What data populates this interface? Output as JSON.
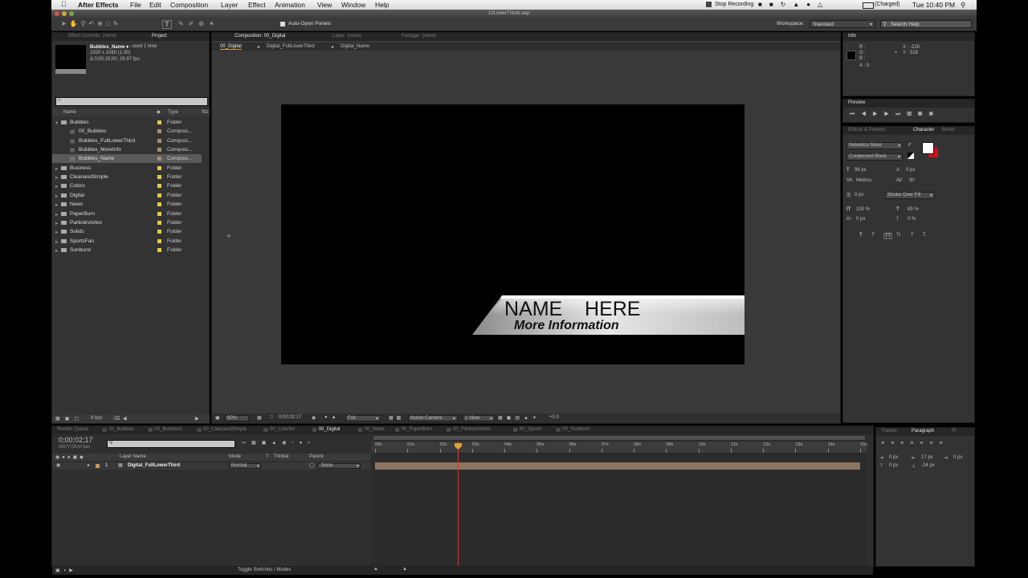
{
  "menubar": {
    "app_name": "After Effects",
    "items": [
      "File",
      "Edit",
      "Composition",
      "Layer",
      "Effect",
      "Animation",
      "View",
      "Window",
      "Help"
    ],
    "stop_recording": "Stop Recording",
    "battery": "(Charged)",
    "clock": "Tue 10:40 PM"
  },
  "window": {
    "title": "10LowerThirds.aep"
  },
  "toolbar": {
    "auto_open": "Auto-Open Panels",
    "workspace_label": "Workspace:",
    "workspace_value": "Standard",
    "search_placeholder": "Search Help"
  },
  "project_panel": {
    "tabs": [
      "Effect Controls: (none)",
      "Project"
    ],
    "selected_item": "Bubbles_Name ▾",
    "used": ", used 1 time",
    "size": "1920 x 1080 (1.00)",
    "duration": "Δ 0;00;15;00, 29.97 fps",
    "search_placeholder": "⌕·",
    "col_name": "Name",
    "col_type": "Type",
    "col_size": "Siz",
    "items": [
      {
        "name": "Bubbles",
        "type": "Folder",
        "level": 0,
        "kind": "folder",
        "open": true
      },
      {
        "name": "00_Bubbles",
        "type": "Composi...",
        "level": 1,
        "kind": "comp"
      },
      {
        "name": "Bubbles_FullLowerThird",
        "type": "Composi...",
        "level": 1,
        "kind": "comp"
      },
      {
        "name": "Bubbles_MoreInfo",
        "type": "Composi...",
        "level": 1,
        "kind": "comp"
      },
      {
        "name": "Bubbles_Name",
        "type": "Composi...",
        "level": 1,
        "kind": "comp",
        "selected": true
      },
      {
        "name": "Business",
        "type": "Folder",
        "level": 0,
        "kind": "folder"
      },
      {
        "name": "CleanandSimple",
        "type": "Folder",
        "level": 0,
        "kind": "folder"
      },
      {
        "name": "Colors",
        "type": "Folder",
        "level": 0,
        "kind": "folder"
      },
      {
        "name": "Digital",
        "type": "Folder",
        "level": 0,
        "kind": "folder"
      },
      {
        "name": "News",
        "type": "Folder",
        "level": 0,
        "kind": "folder"
      },
      {
        "name": "PaperBurn",
        "type": "Folder",
        "level": 0,
        "kind": "folder"
      },
      {
        "name": "ParticleVortex",
        "type": "Folder",
        "level": 0,
        "kind": "folder"
      },
      {
        "name": "Solids",
        "type": "Folder",
        "level": 0,
        "kind": "folder"
      },
      {
        "name": "SportsFan",
        "type": "Folder",
        "level": 0,
        "kind": "folder"
      },
      {
        "name": "Sunburst",
        "type": "Folder",
        "level": 0,
        "kind": "folder"
      }
    ],
    "bpc": "8 bpc"
  },
  "comp_panel": {
    "tabs": [
      "Composition: 00_Digital",
      "Layer: (none)",
      "Footage: (none)"
    ],
    "breadcrumbs": [
      "00_Digital",
      "Digital_FullLowerThird",
      "Digital_Name"
    ],
    "zoom": "50%",
    "timecode": "0;00;02;17",
    "resolution": "Full",
    "camera": "Active Camera",
    "views": "1 View",
    "exposure": "+0.0"
  },
  "lower_third": {
    "name": "NAME    HERE",
    "info": "More Information"
  },
  "info_panel": {
    "title": "Info",
    "r": "R :",
    "g": "G :",
    "b": "B :",
    "a": "A : 0",
    "x": "X : -226",
    "y": "Y : 528"
  },
  "preview_panel": {
    "title": "Preview"
  },
  "character_panel": {
    "tabs": [
      "Effects & Presets",
      "Character",
      "Brush"
    ],
    "font": "Helvetica Neue",
    "style": "Condensed Black",
    "size": "98 px",
    "leading": "0 px",
    "kerning": "Metrics",
    "tracking": "30",
    "stroke": "0 px",
    "stroke_mode": "Stroke Over Fill",
    "vscale": "100 %",
    "hscale": "89 %",
    "baseline": "0 px",
    "tsume": "0 %",
    "styles": [
      "T",
      "T",
      "TT",
      "Tr",
      "T",
      "T,"
    ],
    "fill_color": "#ffffff",
    "stroke_color": "#d0101a"
  },
  "timeline": {
    "tabs": [
      "Render Queue",
      "00_Bubbles",
      "00_Business",
      "00_CleanandSimple",
      "00_Colorful",
      "00_Digital",
      "00_News",
      "00_PaperBurn",
      "00_ParticleVortex",
      "00_Sports",
      "00_Sunburst"
    ],
    "active_tab": 5,
    "timecode": "0;00;02;17",
    "frames": "00077 (29.97 fps)",
    "col_layer": "Layer Name",
    "col_mode": "Mode",
    "col_t": "T",
    "col_trkmat": "TrkMat",
    "col_parent": "Parent",
    "layer_num": "1",
    "layer_name": "Digital_FullLowerThird",
    "layer_mode": "Normal",
    "layer_parent": "None",
    "ruler": [
      "00s",
      "01s",
      "02s",
      "03s",
      "04s",
      "05s",
      "06s",
      "07s",
      "08s",
      "09s",
      "10s",
      "11s",
      "12s",
      "13s",
      "14s",
      "15s"
    ],
    "toggle": "Toggle Switches / Modes"
  },
  "paragraph_panel": {
    "tabs": [
      "Tracker",
      "Paragraph",
      "Pi"
    ],
    "indent1": "0 px",
    "indent2": "17 px",
    "indent3": "0 px",
    "space1": "0 px",
    "space2": "-24 px"
  }
}
